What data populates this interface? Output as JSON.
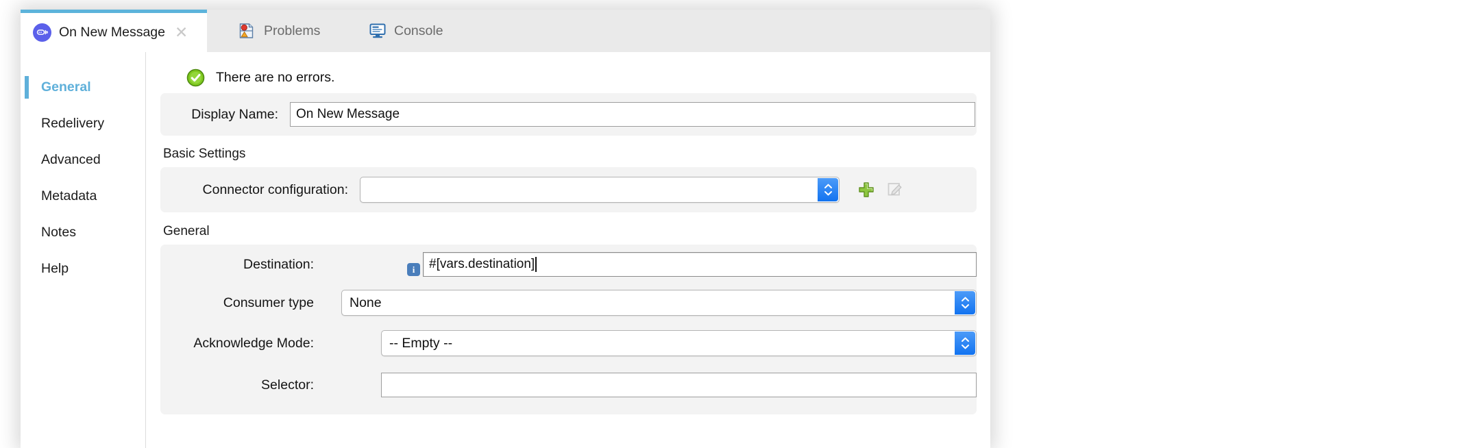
{
  "window": {
    "accent_color": "#5cb3db",
    "tabs": [
      {
        "label": "On New Message",
        "icon": "jms-connector-icon",
        "active": true,
        "closable": true,
        "close_icon": "close-icon"
      },
      {
        "label": "Problems",
        "icon": "problems-icon",
        "active": false,
        "closable": false
      },
      {
        "label": "Console",
        "icon": "console-icon",
        "active": false,
        "closable": false
      }
    ]
  },
  "sidebar": {
    "items": [
      {
        "label": "General",
        "selected": true
      },
      {
        "label": "Redelivery",
        "selected": false
      },
      {
        "label": "Advanced",
        "selected": false
      },
      {
        "label": "Metadata",
        "selected": false
      },
      {
        "label": "Notes",
        "selected": false
      },
      {
        "label": "Help",
        "selected": false
      }
    ]
  },
  "content": {
    "status": {
      "icon": "success-check-icon",
      "text": "There are no errors.",
      "color": "#66b81d"
    },
    "display_name": {
      "label": "Display Name:",
      "value": "On New Message",
      "placeholder": ""
    },
    "basic_settings": {
      "title": "Basic Settings",
      "connector_configuration": {
        "label": "Connector configuration:",
        "value": "",
        "placeholder": "",
        "add_button_icon": "plus-icon",
        "edit_button_icon": "edit-pencil-icon",
        "edit_button_enabled": false
      }
    },
    "general": {
      "title": "General",
      "destination": {
        "label": "Destination:",
        "value": "#[vars.destination]",
        "placeholder": "",
        "expression_icon": "info-icon",
        "focused": true
      },
      "consumer_type": {
        "label": "Consumer type",
        "value": "None",
        "options": [
          "None"
        ]
      },
      "acknowledge_mode": {
        "label": "Acknowledge Mode:",
        "value": "-- Empty --",
        "options": [
          "-- Empty --"
        ]
      },
      "selector": {
        "label": "Selector:",
        "value": "",
        "placeholder": ""
      }
    }
  }
}
